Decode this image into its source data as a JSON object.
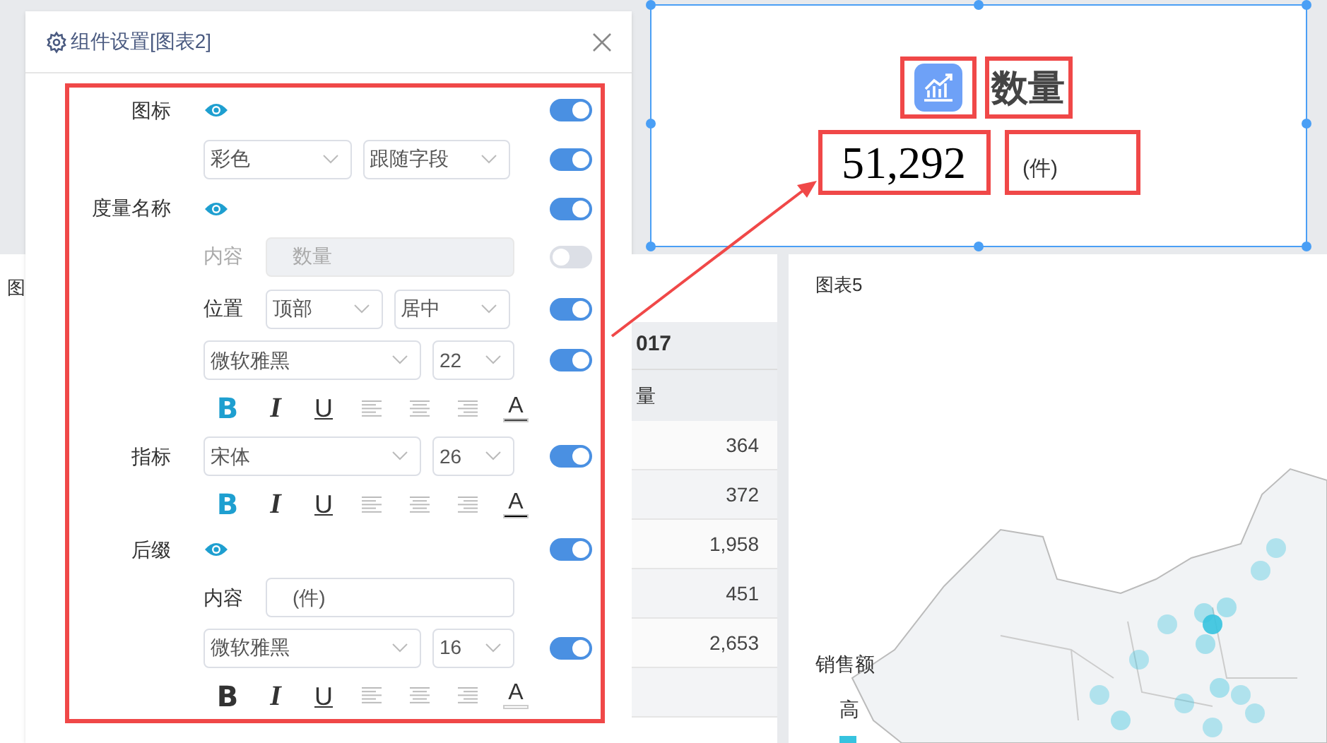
{
  "background": {
    "side_label": "图"
  },
  "dialog": {
    "title": "组件设置[图表2]"
  },
  "settings": [
    {
      "kind": "header",
      "label": "图标",
      "eye": true,
      "on": true
    },
    {
      "kind": "pair",
      "selects": [
        "彩色",
        "跟随字段"
      ],
      "on": true
    },
    {
      "kind": "header",
      "label": "度量名称",
      "eye": true,
      "on": true
    },
    {
      "kind": "input",
      "label": "内容",
      "placeholder": "数量",
      "disabled": true,
      "on": false
    },
    {
      "kind": "pair",
      "label": "位置",
      "selects": [
        "顶部",
        "居中"
      ],
      "on": true
    },
    {
      "kind": "font",
      "selects": [
        "微软雅黑",
        "22"
      ],
      "on": true
    },
    {
      "kind": "format",
      "buttons": [
        {
          "label": "B",
          "selected": true
        },
        {
          "label": "I",
          "selected": false
        },
        {
          "label": "U",
          "selected": false
        }
      ],
      "color_label": "A",
      "color": "#444444"
    },
    {
      "kind": "font",
      "label": "指标",
      "selects": [
        "宋体",
        "26"
      ],
      "on": true
    },
    {
      "kind": "format",
      "buttons": [
        {
          "label": "B",
          "selected": true
        },
        {
          "label": "I",
          "selected": false
        },
        {
          "label": "U",
          "selected": false
        }
      ],
      "color_label": "A",
      "color": "#000000"
    },
    {
      "kind": "header",
      "label": "后缀",
      "eye": true,
      "on": true
    },
    {
      "kind": "input",
      "label": "内容",
      "value": "(件)",
      "disabled": false
    },
    {
      "kind": "font",
      "selects": [
        "微软雅黑",
        "16"
      ],
      "on": true
    },
    {
      "kind": "format",
      "buttons": [
        {
          "label": "B",
          "selected": false
        },
        {
          "label": "I",
          "selected": false
        },
        {
          "label": "U",
          "selected": false
        }
      ],
      "color_label": "A",
      "color": "#ffffff"
    }
  ],
  "kpi_card": {
    "title": "数量",
    "value": "51,292",
    "suffix": "(件)"
  },
  "table": {
    "header": "017",
    "subheader": "量",
    "rows": [
      "364",
      "372",
      "1,958",
      "451",
      "2,653"
    ]
  },
  "map_card": {
    "title": "图表5",
    "legend_title": "销售额",
    "legend_high": "高"
  }
}
